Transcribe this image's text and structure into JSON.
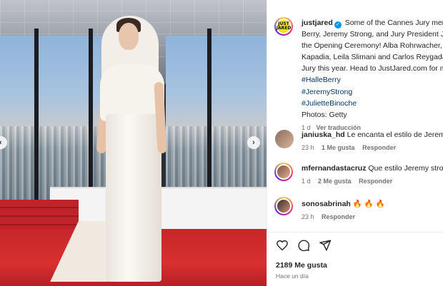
{
  "post": {
    "username": "justjared",
    "logo_text": [
      "JUST",
      "JARED"
    ],
    "caption_first": "Some of the Cannes Jury memb",
    "caption_lines": [
      "Berry, Jeremy Strong, and Jury President Juli",
      "the Opening Ceremony! Alba Rohrwacher, D",
      "Kapadia, Leila Slimani and Carlos Reygadas",
      "Jury this year. Head to JustJared.com for mo"
    ],
    "hashtags": [
      "#HalleBerry",
      "#JeremyStrong",
      "#JulietteBinoche"
    ],
    "credits": "Photos: Getty",
    "time": "1 d",
    "see_translation": "Ver traducción"
  },
  "comments": [
    {
      "user": "janiuska_hd",
      "text": "Le encanta el estilo de Jeremy S",
      "time": "23 h",
      "likes": "1 Me gusta",
      "reply": "Responder"
    },
    {
      "user": "mfernandastacruz",
      "text": "Que estilo Jeremy strong",
      "time": "1 d",
      "likes": "2 Me gusta",
      "reply": "Responder"
    },
    {
      "user": "sonosabrinah",
      "text": "🔥 🔥 🔥",
      "time": "23 h",
      "likes": "",
      "reply": "Responder"
    }
  ],
  "footer": {
    "likes": "2189 Me gusta",
    "ago": "Hace un día"
  },
  "icons": {
    "prev": "‹",
    "next": "›",
    "verified": "✓"
  }
}
